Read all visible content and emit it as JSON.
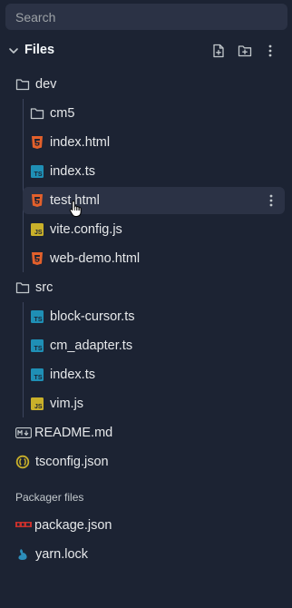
{
  "search": {
    "placeholder": "Search"
  },
  "files": {
    "title": "Files"
  },
  "tree": {
    "dev": "dev",
    "cm5": "cm5",
    "dev_index_html": "index.html",
    "dev_index_ts": "index.ts",
    "test_html": "test.html",
    "vite_config": "vite.config.js",
    "web_demo": "web-demo.html",
    "src": "src",
    "block_cursor": "block-cursor.ts",
    "cm_adapter": "cm_adapter.ts",
    "src_index_ts": "index.ts",
    "vim_js": "vim.js",
    "readme": "README.md",
    "tsconfig": "tsconfig.json"
  },
  "packager": {
    "label": "Packager files",
    "package_json": "package.json",
    "yarn_lock": "yarn.lock"
  },
  "icons": {
    "html": "html5-icon",
    "ts": "typescript-icon",
    "js": "javascript-icon",
    "folder": "folder-icon"
  },
  "colors": {
    "background": "#1c2333",
    "selected": "#2b3245",
    "html": "#e3602b",
    "ts": "#1f8fb5",
    "js": "#c9b02a"
  }
}
